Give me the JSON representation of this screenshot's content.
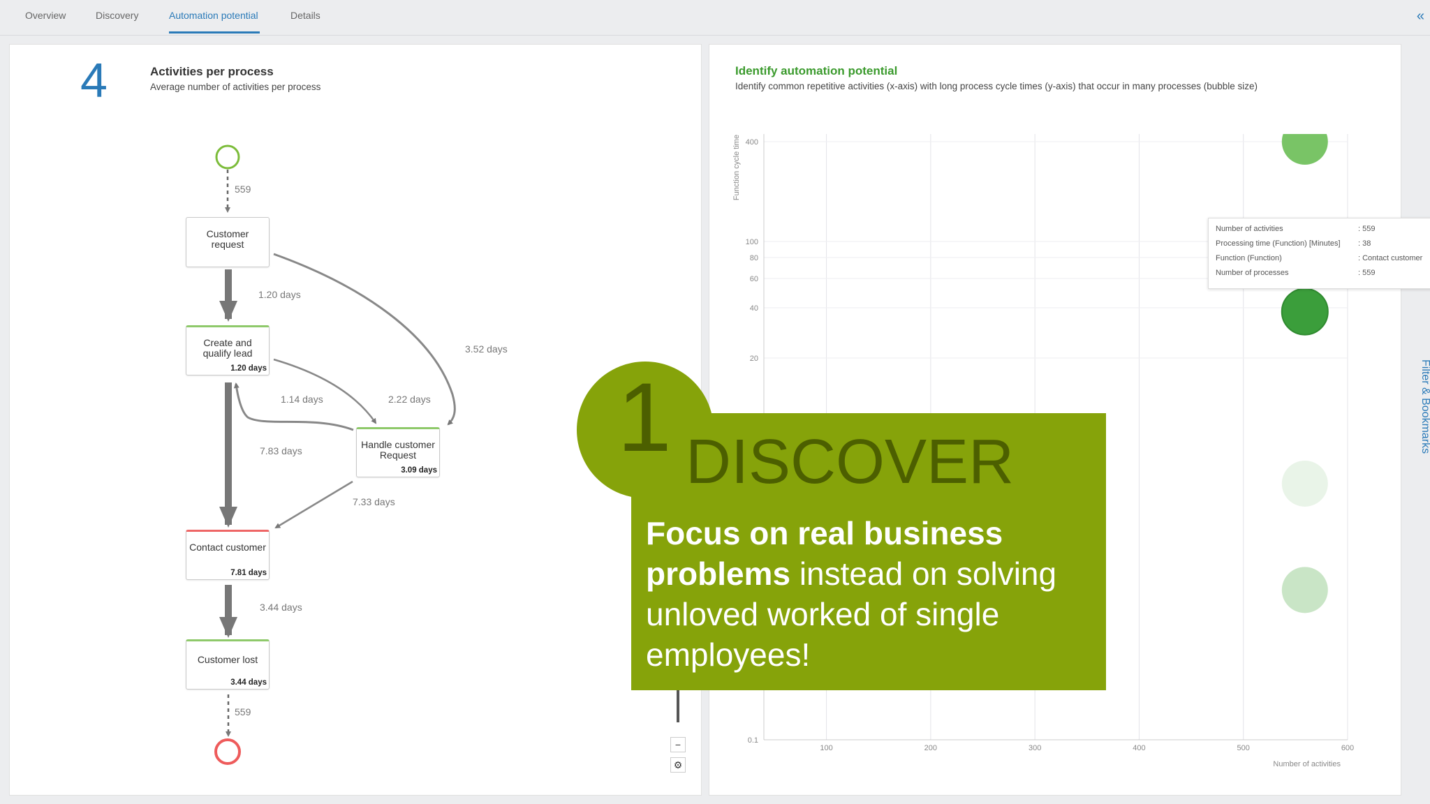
{
  "tabs": [
    {
      "label": "Overview",
      "active": false
    },
    {
      "label": "Discovery",
      "active": false
    },
    {
      "label": "Automation potential",
      "active": true
    },
    {
      "label": "Details",
      "active": false
    }
  ],
  "collapse_icon": "double-chevron-left-icon",
  "kpi": {
    "value": "4",
    "title": "Activities per process",
    "subtitle": "Average number of activities per process"
  },
  "process_map": {
    "nodes": [
      {
        "id": "customer-request",
        "label": "Customer request",
        "duration": ""
      },
      {
        "id": "create-and-qualify-lead",
        "label": "Create and qualify lead",
        "duration": "1.20 days"
      },
      {
        "id": "handle-customer-request",
        "label": "Handle customer Request",
        "duration": "3.09 days"
      },
      {
        "id": "contact-customer",
        "label": "Contact customer",
        "duration": "7.81 days"
      },
      {
        "id": "customer-lost",
        "label": "Customer lost",
        "duration": "3.44 days"
      }
    ],
    "edge_labels": {
      "start_count": "559",
      "req_to_lead": "1.20 days",
      "req_to_handle": "3.52 days",
      "handle_to_lead": "1.14 days",
      "lead_to_handle": "2.22 days",
      "lead_to_contact": "7.83 days",
      "handle_to_contact": "7.33 days",
      "contact_to_lost": "3.44 days",
      "end_count": "559"
    },
    "zoom_out_icon": "minus-icon",
    "settings_icon": "gear-icon"
  },
  "automation_chart": {
    "title": "Identify automation potential",
    "subtitle": "Identify common repetitive activities (x-axis) with long process cycle times (y-axis) that occur in many processes (bubble size)"
  },
  "chart_data": {
    "type": "scatter",
    "xlabel": "Number of activities",
    "ylabel": "Function cycle time",
    "x_ticks": [
      "100",
      "200",
      "300",
      "400",
      "500",
      "600"
    ],
    "y_ticks": [
      "0.1",
      "20",
      "40",
      "60",
      "80",
      "100",
      "400"
    ],
    "y_scale": "log",
    "x_range": [
      40,
      600
    ],
    "y_range": [
      0.1,
      400
    ],
    "points": [
      {
        "x": 559,
        "y": 400,
        "color": "#79c466"
      },
      {
        "x": 559,
        "y": 38,
        "color": "#3b9e3b"
      },
      {
        "x": 559,
        "y": 3.5,
        "color": "#e9f4e8"
      },
      {
        "x": 559,
        "y": 0.8,
        "color": "#c9e5c6"
      }
    ]
  },
  "tooltip": {
    "rows": [
      {
        "label": "Number of activities",
        "value": ": 559"
      },
      {
        "label": "Processing time (Function) [Minutes]",
        "value": ": 38"
      },
      {
        "label": "Function (Function)",
        "value": ": Contact customer"
      },
      {
        "label": "Number of processes",
        "value": ": 559"
      }
    ]
  },
  "side_panel": {
    "label": "Filter & Bookmarks"
  },
  "overlay": {
    "number": "1",
    "heading": "DISCOVER",
    "text_bold": "Focus on real business problems",
    "text_rest": " instead on solving unloved worked of single employees!"
  },
  "colors": {
    "accent": "#2a7ab8",
    "overlay_green": "#86a30a",
    "overlay_dark": "#4c5f00",
    "chart_title_green": "#3a9a2c"
  }
}
